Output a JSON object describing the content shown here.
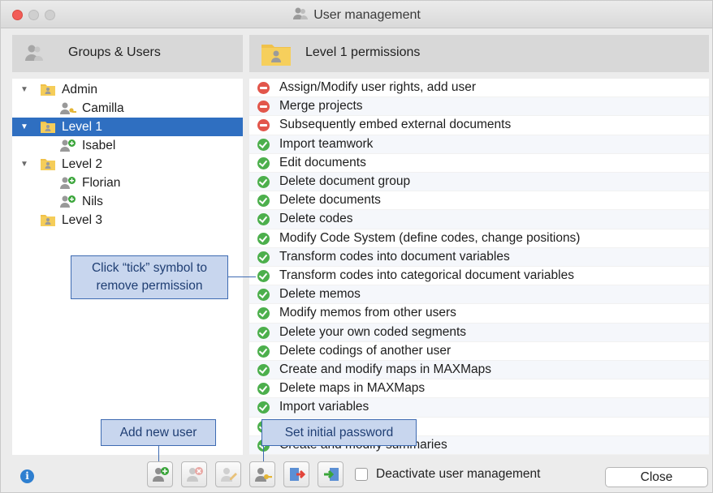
{
  "window": {
    "title": "User management"
  },
  "left_panel": {
    "header": "Groups & Users"
  },
  "right_panel": {
    "header": "Level 1 permissions"
  },
  "tree": [
    {
      "label": "Admin",
      "type": "group",
      "expanded": true,
      "selected": false
    },
    {
      "label": "Camilla",
      "type": "user-key",
      "selected": false
    },
    {
      "label": "Level 1",
      "type": "group",
      "expanded": true,
      "selected": true
    },
    {
      "label": "Isabel",
      "type": "user-add",
      "selected": false
    },
    {
      "label": "Level 2",
      "type": "group",
      "expanded": true,
      "selected": false
    },
    {
      "label": "Florian",
      "type": "user-add",
      "selected": false
    },
    {
      "label": "Nils",
      "type": "user-add",
      "selected": false
    },
    {
      "label": "Level 3",
      "type": "group",
      "expanded": false,
      "selected": false
    }
  ],
  "permissions": [
    {
      "label": "Assign/Modify user rights, add user",
      "allowed": false
    },
    {
      "label": "Merge projects",
      "allowed": false
    },
    {
      "label": "Subsequently embed external documents",
      "allowed": false
    },
    {
      "label": "Import teamwork",
      "allowed": true
    },
    {
      "label": "Edit documents",
      "allowed": true
    },
    {
      "label": "Delete document group",
      "allowed": true
    },
    {
      "label": "Delete documents",
      "allowed": true
    },
    {
      "label": "Delete codes",
      "allowed": true
    },
    {
      "label": "Modify Code System (define codes, change positions)",
      "allowed": true
    },
    {
      "label": "Transform codes into document variables",
      "allowed": true
    },
    {
      "label": "Transform codes into categorical document variables",
      "allowed": true
    },
    {
      "label": "Delete memos",
      "allowed": true
    },
    {
      "label": "Modify memos from other users",
      "allowed": true
    },
    {
      "label": "Delete your own coded segments",
      "allowed": true
    },
    {
      "label": "Delete codings of another user",
      "allowed": true
    },
    {
      "label": "Create and modify maps in MAXMaps",
      "allowed": true
    },
    {
      "label": "Delete maps in MAXMaps",
      "allowed": true
    },
    {
      "label": "Import variables",
      "allowed": true
    },
    {
      "label": "Import variables",
      "allowed": true
    },
    {
      "label": "Create and modify summaries",
      "allowed": true
    }
  ],
  "callouts": {
    "tick": "Click “tick” symbol to remove permission",
    "add_user": "Add new user",
    "set_password": "Set initial password"
  },
  "toolbar": {
    "buttons": [
      "add-user",
      "delete-user",
      "edit",
      "set-password",
      "export",
      "import"
    ],
    "deactivate_label": "Deactivate user management",
    "deactivate_checked": false,
    "close_label": "Close"
  },
  "colors": {
    "selection": "#2f6fc1",
    "allowed": "#4caf4c",
    "denied": "#e2564b",
    "callout_fill": "#c8d6ee",
    "callout_border": "#3e6bb2"
  }
}
